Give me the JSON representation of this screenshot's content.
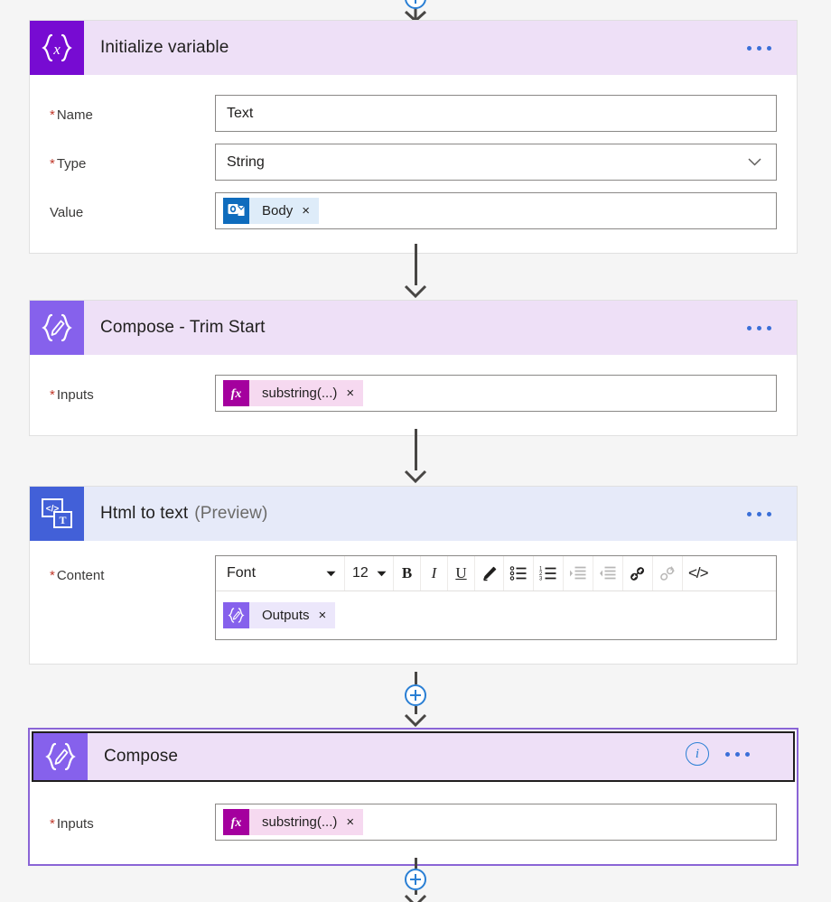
{
  "flow": {
    "cards": [
      {
        "id": "initialize-variable",
        "title": "Initialize variable",
        "title_suffix": "",
        "icon": "braces-x-icon",
        "menu_label": "...",
        "fields": [
          {
            "label": "Name",
            "required": true,
            "type": "text",
            "value": "Text"
          },
          {
            "label": "Type",
            "required": true,
            "type": "select",
            "value": "String"
          },
          {
            "label": "Value",
            "required": false,
            "type": "token",
            "token": {
              "text": "Body",
              "icon": "outlook-icon",
              "remove_label": "×"
            }
          }
        ]
      },
      {
        "id": "compose-trim-start",
        "title": "Compose - Trim Start",
        "title_suffix": "",
        "icon": "braces-pencil-icon",
        "menu_label": "...",
        "fields": [
          {
            "label": "Inputs",
            "required": true,
            "type": "token",
            "token": {
              "text": "substring(...)",
              "icon": "fx-icon",
              "remove_label": "×"
            }
          }
        ]
      },
      {
        "id": "html-to-text",
        "title": "Html to text",
        "title_suffix": "(Preview)",
        "icon": "html-to-text-icon",
        "menu_label": "...",
        "fields": [
          {
            "label": "Content",
            "required": true,
            "type": "richtext",
            "token": {
              "text": "Outputs",
              "icon": "compose-icon",
              "remove_label": "×"
            }
          }
        ]
      },
      {
        "id": "compose",
        "title": "Compose",
        "title_suffix": "",
        "icon": "braces-pencil-icon",
        "selected": true,
        "info_label": "i",
        "menu_label": "...",
        "fields": [
          {
            "label": "Inputs",
            "required": true,
            "type": "token",
            "token": {
              "text": "substring(...)",
              "icon": "fx-icon",
              "remove_label": "×"
            }
          }
        ]
      }
    ]
  },
  "richtext_toolbar": {
    "font_label": "Font",
    "size_label": "12",
    "buttons": [
      {
        "name": "bold-button",
        "glyph": "B",
        "enabled": true
      },
      {
        "name": "italic-button",
        "glyph": "I",
        "enabled": true
      },
      {
        "name": "underline-button",
        "glyph": "U",
        "enabled": true
      },
      {
        "name": "highlight-button",
        "glyph": "",
        "enabled": true
      },
      {
        "name": "bulleted-list-button",
        "glyph": "",
        "enabled": true
      },
      {
        "name": "numbered-list-button",
        "glyph": "",
        "enabled": true
      },
      {
        "name": "increase-indent-button",
        "glyph": "",
        "enabled": false
      },
      {
        "name": "decrease-indent-button",
        "glyph": "",
        "enabled": false
      },
      {
        "name": "link-button",
        "glyph": "",
        "enabled": true
      },
      {
        "name": "unlink-button",
        "glyph": "",
        "enabled": false
      },
      {
        "name": "code-view-button",
        "glyph": "</>",
        "enabled": true
      }
    ]
  },
  "connectors": {
    "add_step_label": "+"
  },
  "colors": {
    "card_header_purple": "#eee0f7",
    "card_header_blue": "#e6eaf9",
    "icon_initvar": "#770bd2",
    "icon_compose": "#8661ec",
    "icon_html": "#4260d8",
    "accent_blue": "#2a7fd4",
    "selected_border": "#8a64d6",
    "required_red": "#c0392b"
  }
}
